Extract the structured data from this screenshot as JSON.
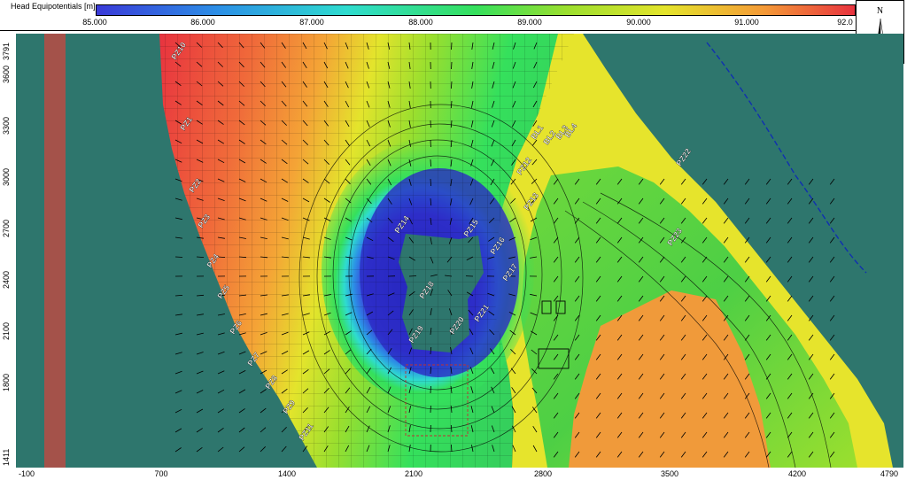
{
  "legend": {
    "title": "Head Equipotentials [m]",
    "ticks": [
      "85.000",
      "86.000",
      "87.000",
      "88.000",
      "89.000",
      "90.000",
      "91.000",
      "92.0"
    ],
    "colors": {
      "low": "#3a3ad8",
      "mid_low": "#2c8fe6",
      "mid": "#35e05c",
      "mid_high": "#e4e42c",
      "high_orange": "#f49a37",
      "high": "#e8333f",
      "background": "#2e766d",
      "brown_strip": "#a4524a"
    }
  },
  "north": {
    "label": "N",
    "icon": "compass-rose-icon"
  },
  "axes": {
    "x_ticks": [
      "-100",
      "700",
      "1400",
      "2100",
      "2800",
      "3500",
      "4200",
      "4790"
    ],
    "y_ticks": [
      "3791",
      "3600",
      "3300",
      "3000",
      "2700",
      "2400",
      "2100",
      "1800",
      "1411"
    ]
  },
  "map": {
    "well_labels": [
      "PZ10",
      "PZ1",
      "PZ2",
      "PZ3",
      "PZ4",
      "PZ5",
      "PZ6",
      "PZ7",
      "PZ8",
      "PZ9",
      "PZ11",
      "BL1",
      "BL2",
      "BL3",
      "BL4",
      "PZ12",
      "PZ13",
      "PZ14",
      "PZ15",
      "PZ16",
      "PZ17",
      "PZ18",
      "PZ19",
      "PZ20",
      "PZ21",
      "PZ22",
      "PZ23"
    ]
  }
}
